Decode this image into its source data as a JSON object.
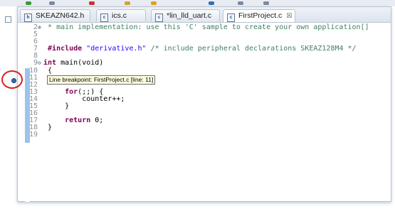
{
  "tabs": [
    {
      "label": "SKEAZN642.h",
      "icon": "header-file-icon",
      "icon_glyph": "h",
      "active": false
    },
    {
      "label": "ics.c",
      "icon": "c-file-icon",
      "icon_glyph": "c",
      "active": false
    },
    {
      "label": "*lin_lld_uart.c",
      "icon": "c-file-icon",
      "icon_glyph": "c",
      "active": false
    },
    {
      "label": "FirstProject.c",
      "icon": "c-file-icon",
      "icon_glyph": "c",
      "active": true,
      "close_glyph": "☒"
    }
  ],
  "code": {
    "line2": {
      "num": "2",
      "marker": "⊕",
      "comment": "* main implementation: use this 'C' sample to create your own application",
      "fold_box": "[]"
    },
    "line5": {
      "num": "5"
    },
    "line6": {
      "num": "6"
    },
    "line7": {
      "num": "7",
      "directive": "#include",
      "string": "\"derivative.h\"",
      "comment": "/* include peripheral declarations SKEAZ128M4 */"
    },
    "line8": {
      "num": "8"
    },
    "line9": {
      "num": "9",
      "marker": "⊖",
      "keyword": "int",
      "text": "main(void)"
    },
    "line10": {
      "num": "10",
      "text": "{"
    },
    "line11": {
      "num": "11"
    },
    "line12": {
      "num": "12"
    },
    "line13": {
      "num": "13",
      "keyword": "for",
      "text": "(;;) {"
    },
    "line14": {
      "num": "14",
      "text": "counter++;"
    },
    "line15": {
      "num": "15",
      "text": "}"
    },
    "line16": {
      "num": "16"
    },
    "line17": {
      "num": "17",
      "keyword": "return",
      "text": "0;"
    },
    "line18": {
      "num": "18",
      "text": "}"
    },
    "line19": {
      "num": "19"
    }
  },
  "tooltip": {
    "text": "Line breakpoint: FirstProject.c [line: 11]"
  },
  "colors": {
    "keyword": "#7f0055",
    "comment": "#3f7f5f",
    "string": "#2a00ff",
    "ruler": "#9ec3ea",
    "highlight_circle": "#d82020"
  }
}
